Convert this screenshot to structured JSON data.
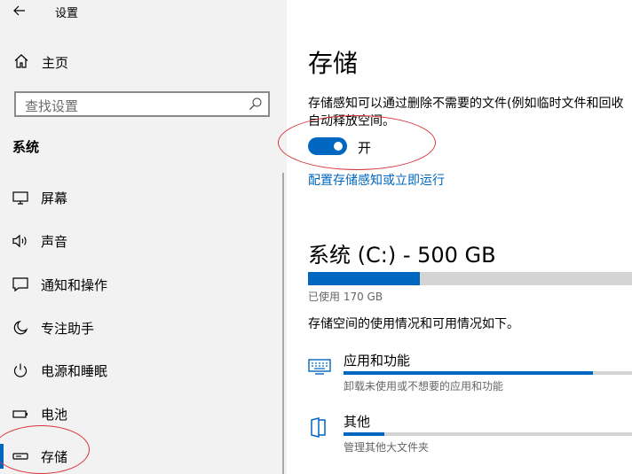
{
  "window": {
    "title": "设置"
  },
  "sidebar": {
    "home_label": "主页",
    "search_placeholder": "查找设置",
    "section_title": "系统",
    "items": [
      {
        "label": "屏幕",
        "icon": "monitor-icon"
      },
      {
        "label": "声音",
        "icon": "speaker-icon"
      },
      {
        "label": "通知和操作",
        "icon": "notification-icon"
      },
      {
        "label": "专注助手",
        "icon": "moon-icon"
      },
      {
        "label": "电源和睡眠",
        "icon": "power-icon"
      },
      {
        "label": "电池",
        "icon": "battery-icon"
      },
      {
        "label": "存储",
        "icon": "storage-icon",
        "selected": true
      }
    ]
  },
  "main": {
    "title": "存储",
    "description_line1": "存储感知可以通过删除不需要的文件(例如临时文件和回收",
    "description_line2": "自动释放空间。",
    "toggle": {
      "state": "on",
      "label": "开"
    },
    "config_link": "配置存储感知或立即运行",
    "drive": {
      "title": "系统 (C:) - 500 GB",
      "used_text": "已使用 170 GB",
      "used_fraction": 0.34
    },
    "usage_desc": "存储空间的使用情况和可用情况如下。",
    "categories": [
      {
        "name": "应用和功能",
        "sub": "卸载未使用或不想要的应用和功能",
        "icon": "apps-keyboard-icon",
        "fraction": 0.85
      },
      {
        "name": "其他",
        "sub": "管理其他大文件夹",
        "icon": "folder-icon",
        "fraction": 0.14
      }
    ]
  },
  "colors": {
    "accent": "#0067c0",
    "annotation": "#d8343c",
    "sidebar_bg": "#f2f2f2"
  }
}
